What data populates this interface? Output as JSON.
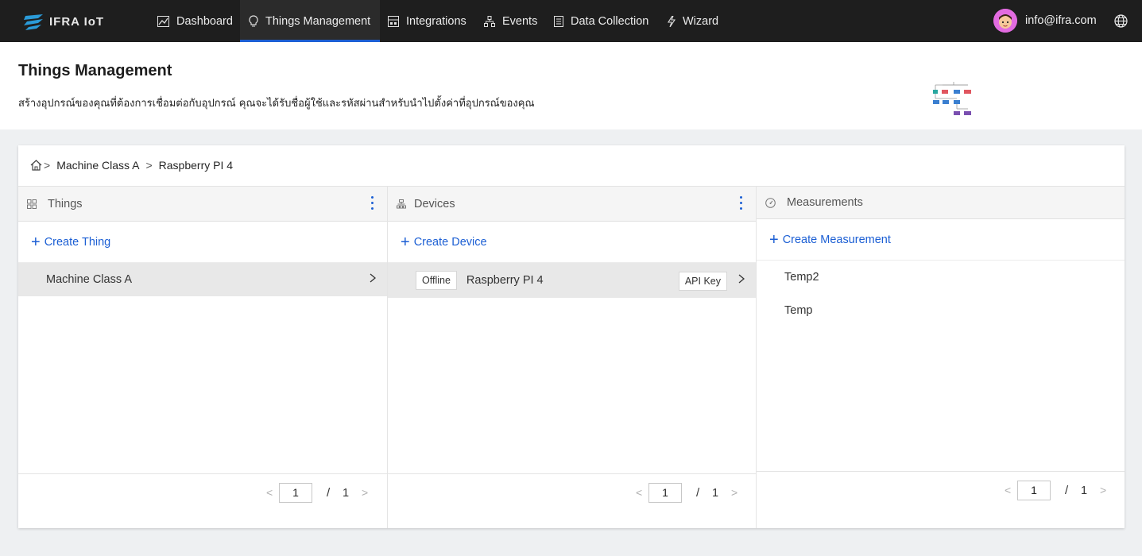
{
  "app": {
    "logo_text": "IFRA IoT"
  },
  "nav": {
    "items": [
      {
        "label": "Dashboard",
        "icon": "chart-line-icon"
      },
      {
        "label": "Things Management",
        "icon": "bulb-icon",
        "active": true
      },
      {
        "label": "Integrations",
        "icon": "integration-icon"
      },
      {
        "label": "Events",
        "icon": "hierarchy-icon"
      },
      {
        "label": "Data Collection",
        "icon": "document-icon"
      },
      {
        "label": "Wizard",
        "icon": "lightning-icon"
      }
    ],
    "user_email": "info@ifra.com",
    "language_icon": "globe-icon"
  },
  "header": {
    "title": "Things Management",
    "description": "สร้างอุปกรณ์ของคุณที่ต้องการเชื่อมต่อกับอุปกรณ์ คุณจะได้รับชื่อผู้ใช้และรหัสผ่านสำหรับนำไปตั้งค่าที่อุปกรณ์ของคุณ"
  },
  "breadcrumb": {
    "items": [
      "Machine Class A",
      "Raspberry PI 4"
    ]
  },
  "columns": {
    "things": {
      "title": "Things",
      "create_label": "Create Thing",
      "rows": [
        {
          "label": "Machine Class A"
        }
      ],
      "page": "1",
      "total": "1"
    },
    "devices": {
      "title": "Devices",
      "create_label": "Create Device",
      "rows": [
        {
          "status": "Offline",
          "label": "Raspberry PI 4",
          "api_key_label": "API Key"
        }
      ],
      "page": "1",
      "total": "1"
    },
    "measurements": {
      "title": "Measurements",
      "create_label": "Create Measurement",
      "rows": [
        {
          "label": "Temp2"
        },
        {
          "label": "Temp"
        }
      ],
      "page": "1",
      "total": "1"
    }
  },
  "colors": {
    "accent": "#1c5fd4",
    "nav_bg": "#1e1e1e",
    "avatar": "#e26be0"
  }
}
